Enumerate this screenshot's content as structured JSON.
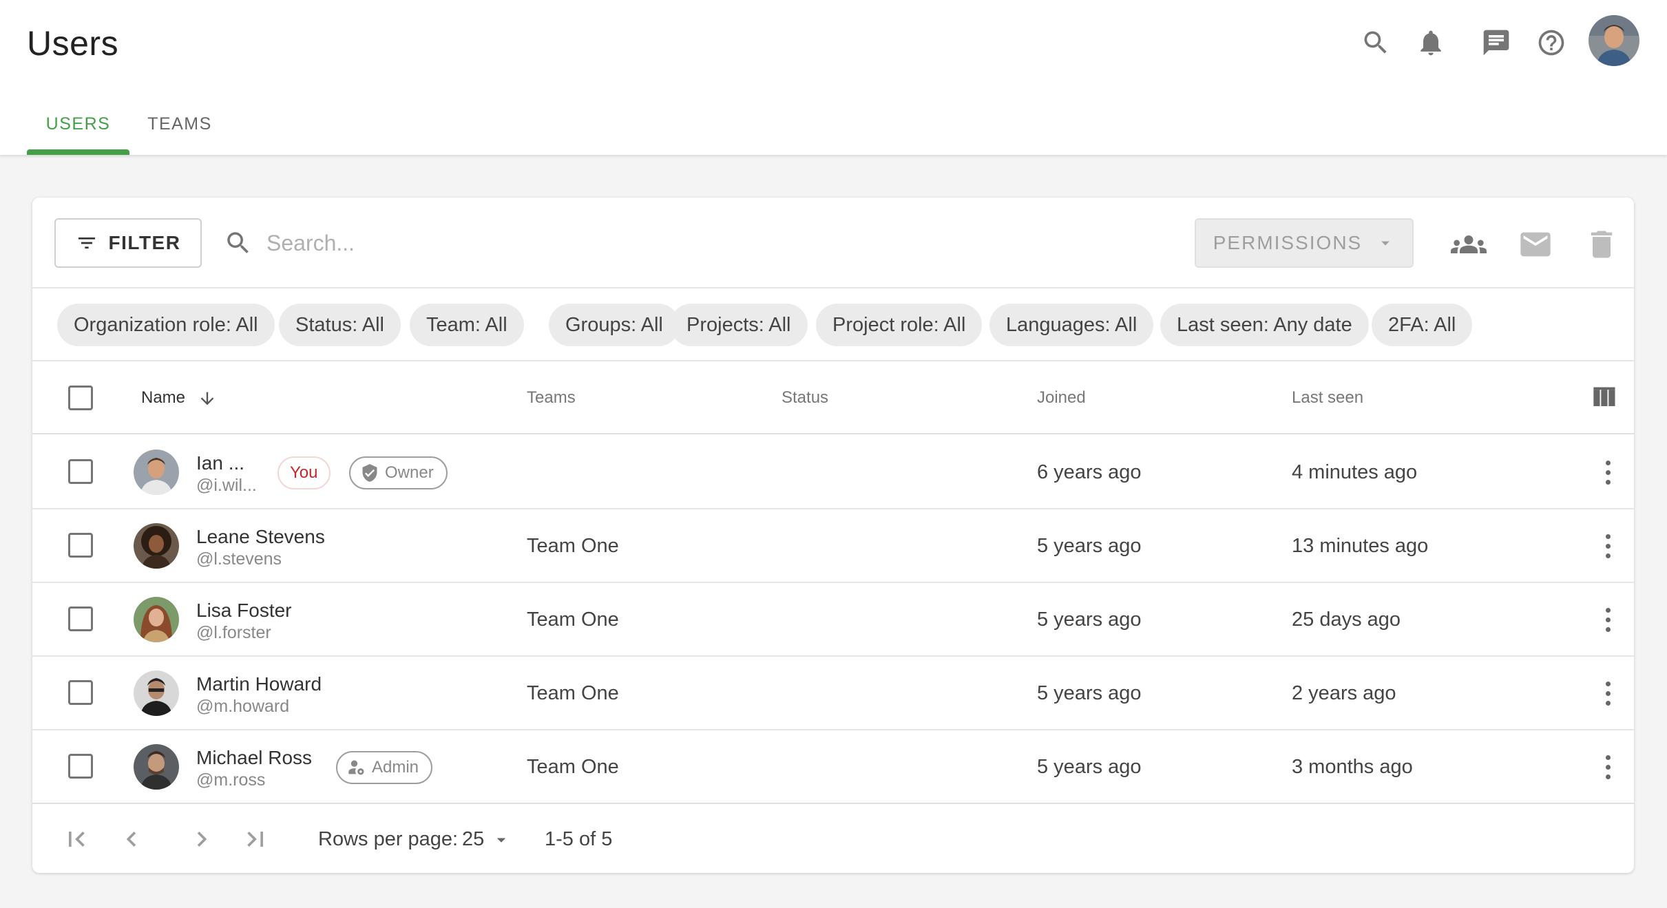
{
  "header": {
    "title": "Users",
    "icons": [
      "search-icon",
      "bell-icon",
      "chat-icon",
      "help-icon",
      "avatar"
    ]
  },
  "tabs": [
    {
      "label": "USERS",
      "active": true
    },
    {
      "label": "TEAMS",
      "active": false
    }
  ],
  "toolbar": {
    "filter_label": "FILTER",
    "search_placeholder": "Search...",
    "permissions_label": "PERMISSIONS",
    "icons": [
      "group-icon",
      "mail-icon",
      "trash-icon"
    ]
  },
  "chips": [
    "Organization role: All",
    "Status: All",
    "Team: All",
    "Groups: All",
    "Projects: All",
    "Project role: All",
    "Languages: All",
    "Last seen: Any date",
    "2FA: All"
  ],
  "table": {
    "columns": {
      "name": "Name",
      "teams": "Teams",
      "status": "Status",
      "joined": "Joined",
      "last_seen": "Last seen"
    },
    "rows": [
      {
        "name": "Ian ...",
        "handle": "@i.wil...",
        "you": "You",
        "role": "Owner",
        "team": "",
        "status": "",
        "joined": "6 years ago",
        "last_seen": "4 minutes ago"
      },
      {
        "name": "Leane Stevens",
        "handle": "@l.stevens",
        "you": "",
        "role": "",
        "team": "Team One",
        "status": "",
        "joined": "5 years ago",
        "last_seen": "13 minutes ago"
      },
      {
        "name": "Lisa Foster",
        "handle": "@l.forster",
        "you": "",
        "role": "",
        "team": "Team One",
        "status": "",
        "joined": "5 years ago",
        "last_seen": "25 days ago"
      },
      {
        "name": "Martin Howard",
        "handle": "@m.howard",
        "you": "",
        "role": "",
        "team": "Team One",
        "status": "",
        "joined": "5 years ago",
        "last_seen": "2 years ago"
      },
      {
        "name": "Michael Ross",
        "handle": "@m.ross",
        "you": "",
        "role": "Admin",
        "team": "Team One",
        "status": "",
        "joined": "5 years ago",
        "last_seen": "3 months ago"
      }
    ]
  },
  "footer": {
    "rows_per_page_label": "Rows per page:",
    "rows_per_page_value": "25",
    "range": "1-5 of 5"
  },
  "colors": {
    "accent": "#43a047",
    "you_badge": "#c62828"
  }
}
